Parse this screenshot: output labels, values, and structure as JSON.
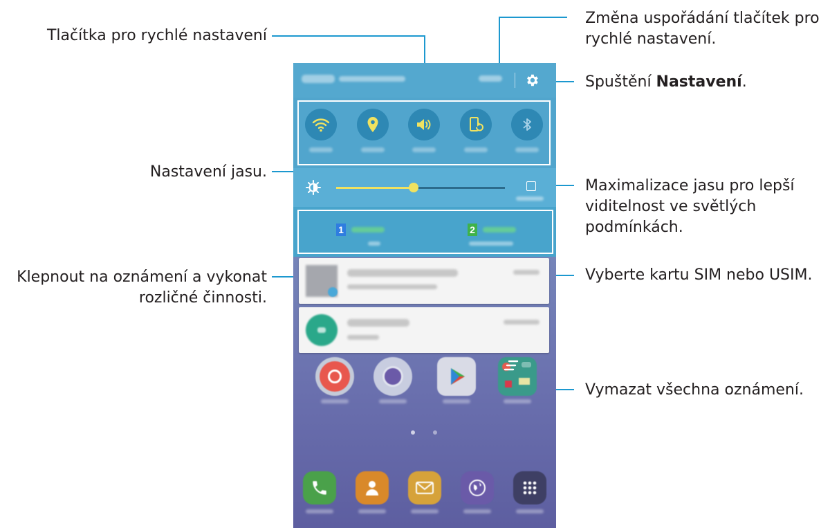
{
  "callouts": {
    "quick_buttons": "Tlačítka pro rychlé nastavení",
    "rearrange_line1": "Změna uspořádání tlačítek pro",
    "rearrange_line2": "rychlé nastavení.",
    "launch_settings_prefix": "Spuštění ",
    "launch_settings_bold": "Nastavení",
    "launch_settings_suffix": ".",
    "brightness": "Nastavení jasu.",
    "max_brightness_line1": "Maximalizace jasu pro lepší",
    "max_brightness_line2": "viditelnost ve světlých",
    "max_brightness_line3": "podmínkách.",
    "notification_line1": "Klepnout na oznámení a vykonat",
    "notification_line2": "rozličné činnosti.",
    "select_sim": "Vyberte kartu SIM nebo USIM.",
    "clear_all": "Vymazat všechna oznámení."
  },
  "phone": {
    "quick_settings": [
      {
        "icon": "wifi-icon",
        "active": true
      },
      {
        "icon": "location-icon",
        "active": true
      },
      {
        "icon": "sound-icon",
        "active": true
      },
      {
        "icon": "screen-rotation-icon",
        "active": true
      },
      {
        "icon": "bluetooth-icon",
        "active": false
      }
    ],
    "brightness_level": 0.46,
    "sim_cards": [
      {
        "number": "1",
        "color": "#2f7de0"
      },
      {
        "number": "2",
        "color": "#3fb24a"
      }
    ],
    "dock": [
      {
        "icon": "phone-icon",
        "color": "#4aa14a"
      },
      {
        "icon": "contacts-icon",
        "color": "#d9892a"
      },
      {
        "icon": "messages-icon",
        "color": "#d6a23a"
      },
      {
        "icon": "internet-icon",
        "color": "#6a5aa8"
      },
      {
        "icon": "apps-icon",
        "color": "#3e3f64"
      }
    ],
    "colors": {
      "panel": "#51a5cd",
      "accent_yellow": "#f0e260",
      "callout_line": "#1c98cf"
    }
  }
}
